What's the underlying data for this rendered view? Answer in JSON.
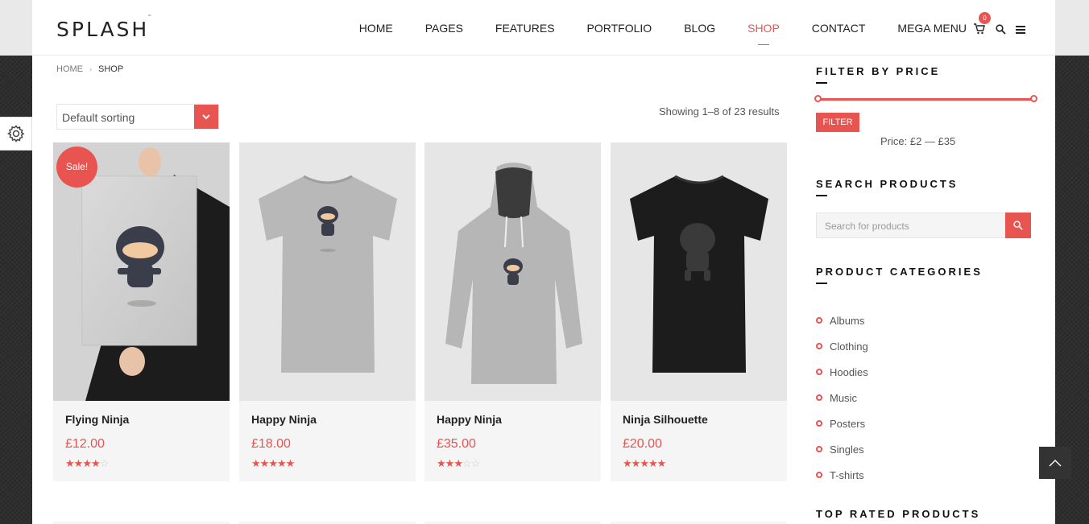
{
  "brand": {
    "logo": "SPLASH",
    "tm": "™"
  },
  "nav": [
    {
      "label": "HOME",
      "active": false
    },
    {
      "label": "PAGES",
      "active": false
    },
    {
      "label": "FEATURES",
      "active": false
    },
    {
      "label": "PORTFOLIO",
      "active": false
    },
    {
      "label": "BLOG",
      "active": false
    },
    {
      "label": "SHOP",
      "active": true
    },
    {
      "label": "CONTACT",
      "active": false
    },
    {
      "label": "MEGA MENU",
      "active": false
    }
  ],
  "cart": {
    "count": "0"
  },
  "breadcrumb": {
    "home": "HOME",
    "current": "SHOP"
  },
  "sorting": {
    "selected": "Default sorting"
  },
  "results": "Showing 1–8 of 23 results",
  "products": [
    {
      "name": "Flying Ninja",
      "price": "£12.00",
      "rating": 4,
      "sale": "Sale!"
    },
    {
      "name": "Happy Ninja",
      "price": "£18.00",
      "rating": 5
    },
    {
      "name": "Happy Ninja",
      "price": "£35.00",
      "rating": 3
    },
    {
      "name": "Ninja Silhouette",
      "price": "£20.00",
      "rating": 5
    }
  ],
  "sidebar": {
    "filter_title": "FILTER BY PRICE",
    "filter_button": "FILTER",
    "price_range": "Price: £2 — £35",
    "search_title": "SEARCH PRODUCTS",
    "search_placeholder": "Search for products",
    "categories_title": "PRODUCT CATEGORIES",
    "categories": [
      "Albums",
      "Clothing",
      "Hoodies",
      "Music",
      "Posters",
      "Singles",
      "T-shirts"
    ],
    "top_rated_title": "TOP RATED PRODUCTS"
  },
  "colors": {
    "accent": "#e8544f"
  }
}
